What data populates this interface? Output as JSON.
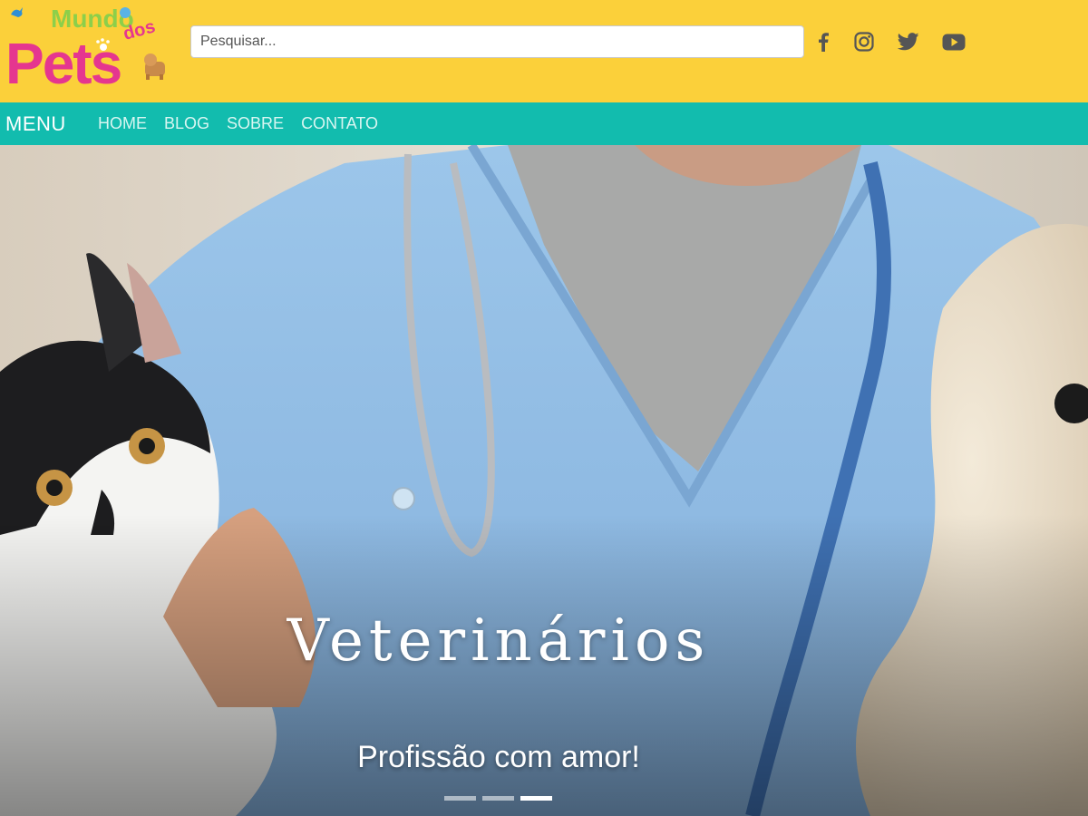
{
  "header": {
    "logo": {
      "line1": "Mundo",
      "line2": "dos",
      "line3": "Pets"
    },
    "search": {
      "placeholder": "Pesquisar...",
      "value": ""
    },
    "social_icons": [
      "facebook-icon",
      "instagram-icon",
      "twitter-icon",
      "youtube-icon"
    ],
    "background_color": "#fbd03a"
  },
  "nav": {
    "menu_label": "MENU",
    "items": [
      {
        "label": "HOME"
      },
      {
        "label": "BLOG"
      },
      {
        "label": "SOBRE"
      },
      {
        "label": "CONTATO"
      }
    ],
    "background_color": "#12bcae"
  },
  "hero": {
    "title": "Veterinários",
    "subtitle": "Profissão com amor!",
    "slides_count": 3,
    "active_slide": 3
  }
}
